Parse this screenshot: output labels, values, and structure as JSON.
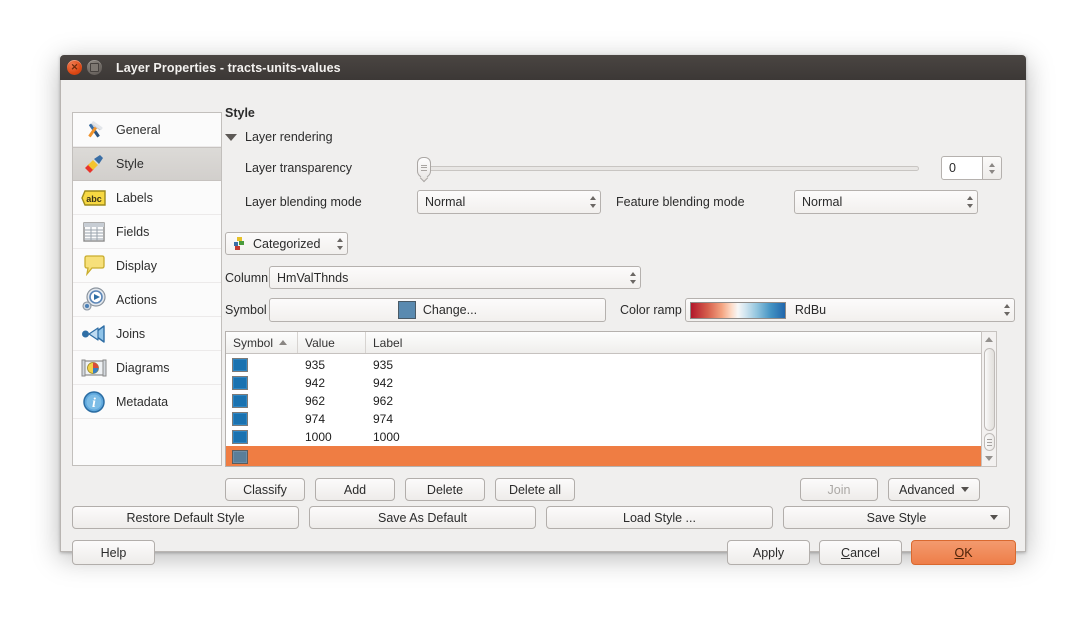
{
  "window": {
    "title": "Layer Properties - tracts-units-values",
    "close_icon": "close-icon",
    "maximize_icon": "maximize-icon"
  },
  "sidebar": {
    "items": [
      {
        "label": "General",
        "icon": "hammer-wrench-icon",
        "selected": false
      },
      {
        "label": "Style",
        "icon": "paintbrush-icon",
        "selected": true
      },
      {
        "label": "Labels",
        "icon": "abc-label-icon",
        "selected": false
      },
      {
        "label": "Fields",
        "icon": "table-fields-icon",
        "selected": false
      },
      {
        "label": "Display",
        "icon": "speech-bubble-icon",
        "selected": false
      },
      {
        "label": "Actions",
        "icon": "gear-play-icon",
        "selected": false
      },
      {
        "label": "Joins",
        "icon": "join-arrow-icon",
        "selected": false
      },
      {
        "label": "Diagrams",
        "icon": "pie-chart-icon",
        "selected": false
      },
      {
        "label": "Metadata",
        "icon": "info-icon",
        "selected": false
      }
    ]
  },
  "style_panel": {
    "heading": "Style",
    "layer_rendering": {
      "group_label": "Layer rendering",
      "expander_icon": "triangle-down-icon",
      "transparency_label": "Layer transparency",
      "transparency_value": "0",
      "transparency_slider_position_pct": 0,
      "layer_blending_label": "Layer blending mode",
      "layer_blending_value": "Normal",
      "feature_blending_label": "Feature blending mode",
      "feature_blending_value": "Normal"
    },
    "renderer": {
      "type_value": "Categorized",
      "type_icon": "categorized-icon",
      "column_label": "Column",
      "column_value": "HmValThnds",
      "symbol_label": "Symbol",
      "symbol_change_label": "Change...",
      "symbol_swatch_color": "#5a8ab0",
      "color_ramp_label": "Color ramp",
      "color_ramp_value": "RdBu"
    },
    "table": {
      "columns": [
        "Symbol",
        "Value",
        "Label"
      ],
      "sort_column": "Symbol",
      "sort_icon": "sort-ascending-icon",
      "rows": [
        {
          "symbol_color": "#1a72b0",
          "value": "935",
          "label": "935",
          "selected": false
        },
        {
          "symbol_color": "#1a72b0",
          "value": "942",
          "label": "942",
          "selected": false
        },
        {
          "symbol_color": "#1a72b0",
          "value": "962",
          "label": "962",
          "selected": false
        },
        {
          "symbol_color": "#1a72b0",
          "value": "974",
          "label": "974",
          "selected": false
        },
        {
          "symbol_color": "#1a72b0",
          "value": "1000",
          "label": "1000",
          "selected": false
        },
        {
          "symbol_color": "#5a7e99",
          "value": "",
          "label": "",
          "selected": true
        }
      ],
      "selection_color": "#ef7d43",
      "scrollbar": {
        "up_icon": "scroll-up-icon",
        "down_icon": "scroll-down-icon",
        "grip_icon": "scroll-grip-icon"
      }
    },
    "class_buttons": {
      "classify": "Classify",
      "add": "Add",
      "delete": "Delete",
      "delete_all": "Delete all",
      "join": "Join",
      "join_disabled": true,
      "advanced": "Advanced",
      "advanced_caret_icon": "chevron-down-icon"
    }
  },
  "style_actions": {
    "restore_default": "Restore Default Style",
    "save_as_default": "Save As Default",
    "load_style": "Load Style ...",
    "save_style": "Save Style",
    "save_style_caret_icon": "chevron-down-icon"
  },
  "dialog_buttons": {
    "help": "Help",
    "apply": "Apply",
    "cancel_prefix": "",
    "cancel_mnemonic": "C",
    "cancel_suffix": "ancel",
    "ok_mnemonic": "O",
    "ok_suffix": "K",
    "ok_accent_color": "#ee7e49"
  }
}
